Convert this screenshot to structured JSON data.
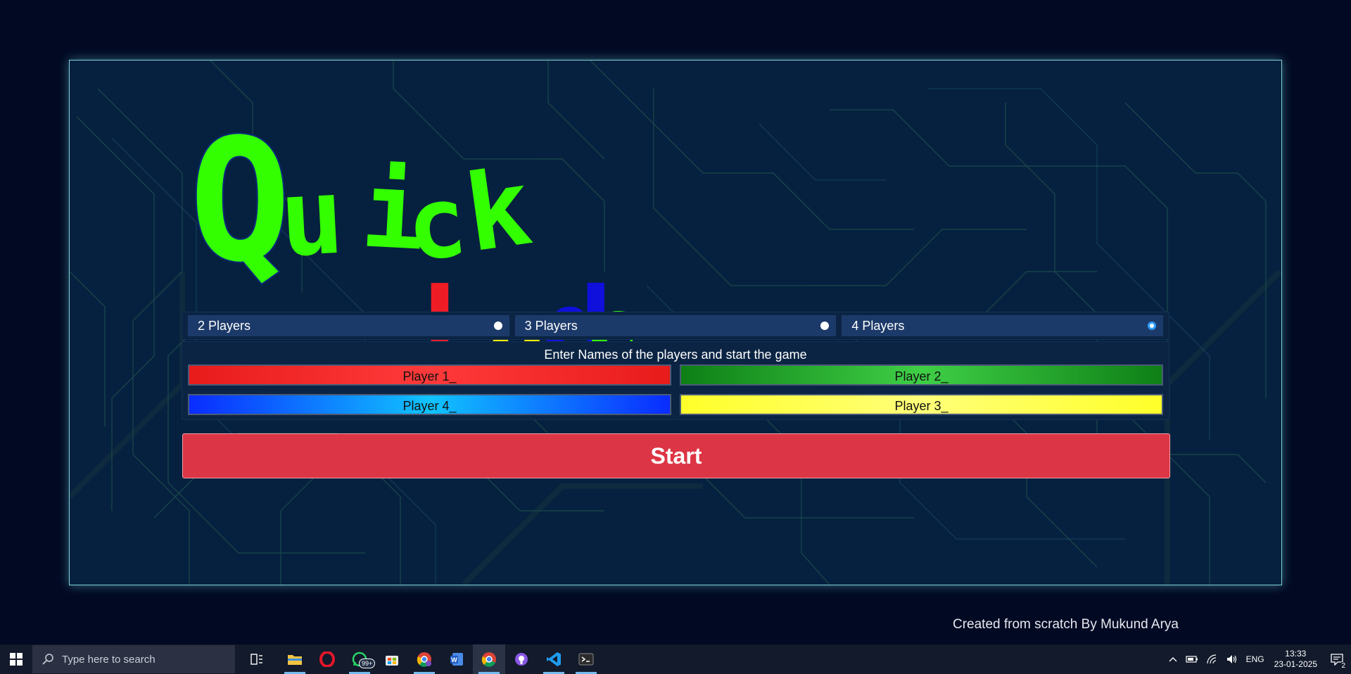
{
  "app": {
    "logo": {
      "word1": [
        "Q",
        "u",
        "i",
        "c",
        "k"
      ],
      "word2": [
        "L",
        "u",
        "d",
        "o"
      ],
      "colors": {
        "quick": "#33ff00",
        "L": "#ee1c25",
        "u": "#ffee00",
        "d": "#1010dd",
        "o": "#33ff00"
      }
    },
    "player_count": {
      "options": [
        {
          "label": "2 Players",
          "selected": false
        },
        {
          "label": "3 Players",
          "selected": false
        },
        {
          "label": "4 Players",
          "selected": true
        }
      ]
    },
    "names": {
      "title": "Enter Names of the players and start the game",
      "fields": [
        {
          "value": "Player 1_",
          "color": "red"
        },
        {
          "value": "Player 2_",
          "color": "green"
        },
        {
          "value": "Player 4_",
          "color": "blue"
        },
        {
          "value": "Player 3_",
          "color": "yellow"
        }
      ]
    },
    "start_label": "Start",
    "credit": "Created from scratch By Mukund Arya"
  },
  "taskbar": {
    "search_placeholder": "Type here to search",
    "whatsapp_badge": "99+",
    "icons": [
      "windows-icon",
      "task-view-icon",
      "file-explorer-icon",
      "opera-icon",
      "whatsapp-icon",
      "store-icon",
      "chrome-profile-icon",
      "word-icon",
      "chrome-icon",
      "github-icon",
      "vscode-icon",
      "terminal-icon"
    ],
    "tray": {
      "language": "ENG",
      "time": "13:33",
      "date": "23-01-2025",
      "notification_count": "2"
    }
  },
  "colors": {
    "page_bg": "#020923",
    "frame_bg": "#06213f",
    "start_button": "#dc3545",
    "option_bg": "#1c3a69"
  }
}
